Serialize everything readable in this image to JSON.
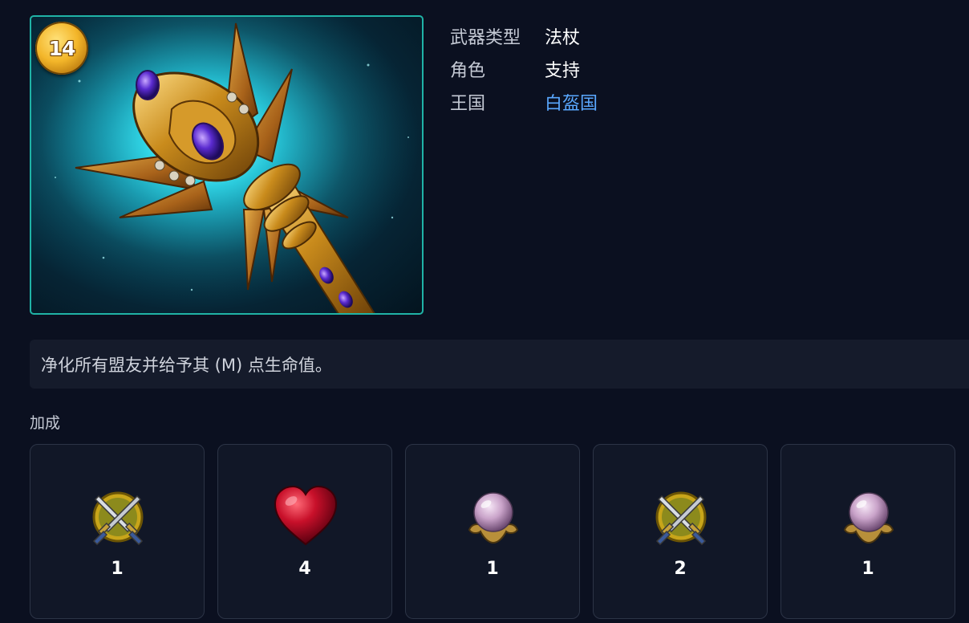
{
  "item": {
    "level": "14",
    "image_icon": "golden-staff-icon"
  },
  "info": {
    "rows": [
      {
        "label": "武器类型",
        "value": "法杖"
      },
      {
        "label": "角色",
        "value": "支持"
      },
      {
        "label": "王国",
        "value": "白盔国"
      }
    ]
  },
  "description": "净化所有盟友并给予其 (M) 点生命值。",
  "bonuses": {
    "title": "加成",
    "items": [
      {
        "icon": "crossed-swords-icon",
        "count": "1"
      },
      {
        "icon": "heart-icon",
        "count": "4"
      },
      {
        "icon": "crystal-orb-icon",
        "count": "1"
      },
      {
        "icon": "crossed-swords-icon",
        "count": "2"
      },
      {
        "icon": "crystal-orb-icon",
        "count": "1"
      }
    ]
  },
  "colors": {
    "background": "#0b1020",
    "card_border": "#20b3a6",
    "link": "#5aa8ff"
  }
}
